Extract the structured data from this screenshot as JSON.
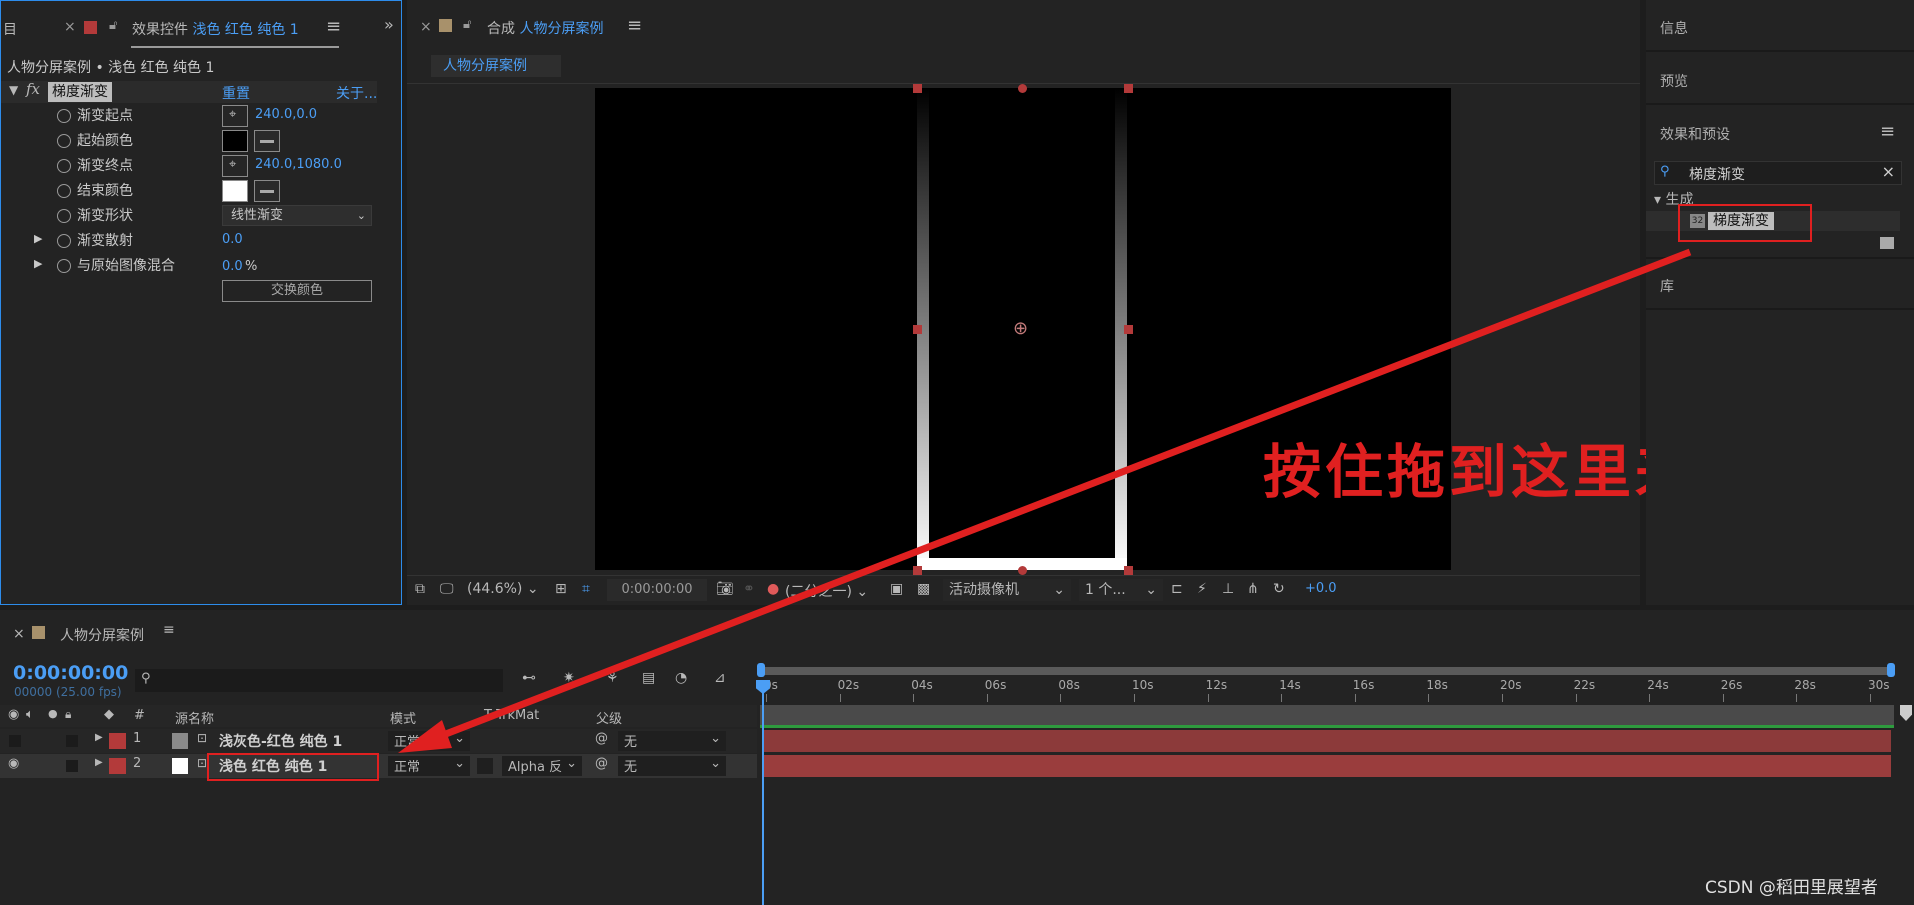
{
  "effect_controls": {
    "tab_prefix": "目",
    "tab_label": "效果控件",
    "tab_layer": "浅色 红色 纯色 1",
    "breadcrumb": "人物分屏案例 • 浅色 红色 纯色 1",
    "fx": "fx",
    "effect_name": "梯度渐变",
    "reset": "重置",
    "about": "关于...",
    "props": [
      {
        "label": "渐变起点",
        "value": "240.0,0.0"
      },
      {
        "label": "起始颜色",
        "color": "#000000"
      },
      {
        "label": "渐变终点",
        "value": "240.0,1080.0"
      },
      {
        "label": "结束颜色",
        "color": "#ffffff"
      },
      {
        "label": "渐变形状",
        "value": "线性渐变"
      },
      {
        "label": "渐变散射",
        "value": "0.0"
      },
      {
        "label": "与原始图像混合",
        "value": "0.0",
        "unit": "%"
      }
    ],
    "swap_button": "交换颜色"
  },
  "composition": {
    "tab_label": "合成",
    "tab_name": "人物分屏案例",
    "subtab": "人物分屏案例",
    "toolbar": {
      "zoom": "(44.6%)",
      "timecode": "0:00:00:00",
      "resolution": "(二分之一)",
      "camera": "活动摄像机",
      "views": "1 个...",
      "exposure": "+0.0"
    },
    "annotation": "按住拖到这里来"
  },
  "right_panel": {
    "info": "信息",
    "preview": "预览",
    "effects_presets": "效果和预设",
    "search_value": "梯度渐变",
    "category": "生成",
    "effect_item": "梯度渐变",
    "effect_badge": "32",
    "library": "库"
  },
  "timeline": {
    "tab_name": "人物分屏案例",
    "timecode": "0:00:00:00",
    "frame_info": "00000 (25.00 fps)",
    "columns": {
      "num": "#",
      "source": "源名称",
      "mode": "模式",
      "trkmat": "T  TrkMat",
      "parent": "父级"
    },
    "layers": [
      {
        "num": "1",
        "name": "浅灰色-红色 纯色 1",
        "mode": "正常",
        "trkmat": "",
        "parent": "无",
        "swatch": "#8a8a8a"
      },
      {
        "num": "2",
        "name": "浅色 红色 纯色 1",
        "mode": "正常",
        "trkmat": "Alpha 反",
        "parent": "无",
        "swatch": "#ffffff"
      }
    ],
    "ruler": [
      "0s",
      "02s",
      "04s",
      "06s",
      "08s",
      "10s",
      "12s",
      "14s",
      "16s",
      "18s",
      "20s",
      "22s",
      "24s",
      "26s",
      "28s",
      "30s"
    ]
  },
  "watermark": "CSDN @稻田里展望者",
  "colors": {
    "accent": "#4b9ef5",
    "annotation": "#e02020",
    "layer_bar": "#8c3a3a",
    "label_red": "#b33a3a"
  }
}
